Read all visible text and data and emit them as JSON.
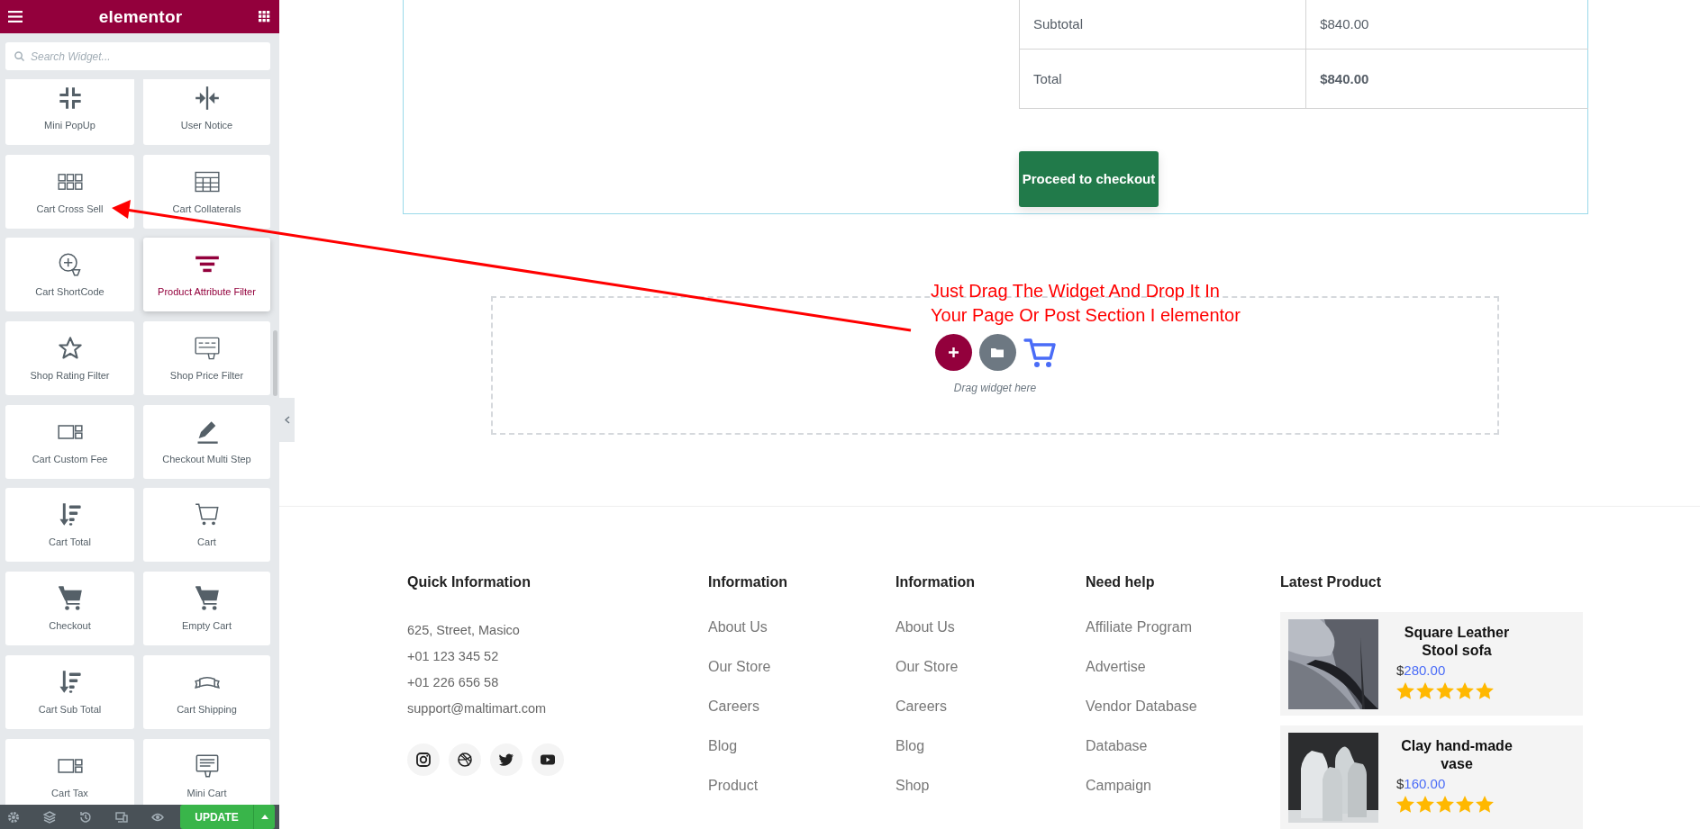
{
  "sidebar": {
    "title": "elementor",
    "search": {
      "placeholder": "Search Widget..."
    },
    "widgets": [
      {
        "label": "Mini PopUp",
        "selected": false
      },
      {
        "label": "User Notice",
        "selected": false
      },
      {
        "label": "Cart Cross Sell",
        "selected": false
      },
      {
        "label": "Cart Collaterals",
        "selected": false
      },
      {
        "label": "Cart ShortCode",
        "selected": false
      },
      {
        "label": "Product Attribute Filter",
        "selected": true
      },
      {
        "label": "Shop Rating Filter",
        "selected": false
      },
      {
        "label": "Shop Price Filter",
        "selected": false
      },
      {
        "label": "Cart Custom Fee",
        "selected": false
      },
      {
        "label": "Checkout Multi Step",
        "selected": false
      },
      {
        "label": "Cart Total",
        "selected": false
      },
      {
        "label": "Cart",
        "selected": false
      },
      {
        "label": "Checkout",
        "selected": false
      },
      {
        "label": "Empty Cart",
        "selected": false
      },
      {
        "label": "Cart Sub Total",
        "selected": false
      },
      {
        "label": "Cart Shipping",
        "selected": false
      },
      {
        "label": "Cart Tax",
        "selected": false
      },
      {
        "label": "Mini Cart",
        "selected": false
      }
    ],
    "update_button": "UPDATE"
  },
  "cart_totals": {
    "rows": [
      {
        "label": "Subtotal",
        "value": "$840.00",
        "strong": false
      },
      {
        "label": "Total",
        "value": "$840.00",
        "strong": true
      }
    ],
    "checkout_button": "Proceed to checkout"
  },
  "annotation": {
    "lines": [
      "Just Drag The Widget And Drop It In",
      "Your Page Or Post Section I elementor"
    ]
  },
  "drop_zone": {
    "hint": "Drag widget here"
  },
  "footer": {
    "contact": {
      "heading": "Quick Information",
      "lines": [
        "625, Street, Masico",
        "+01 123 345 52",
        "+01 226 656 58",
        "support@maltimart.com"
      ]
    },
    "link_columns": [
      {
        "heading": "Information",
        "links": [
          "About Us",
          "Our Store",
          "Careers",
          "Blog",
          "Product"
        ]
      },
      {
        "heading": "Information",
        "links": [
          "About Us",
          "Our Store",
          "Careers",
          "Blog",
          "Shop"
        ]
      },
      {
        "heading": "Need help",
        "links": [
          "Affiliate Program",
          "Advertise",
          "Vendor Database",
          "Database",
          "Campaign"
        ]
      }
    ],
    "latest": {
      "heading": "Latest Product",
      "products": [
        {
          "name": "Square Leather Stool sofa",
          "currency": "$",
          "amount": "280.00",
          "stars": 5
        },
        {
          "name": "Clay hand-made vase",
          "currency": "$",
          "amount": "160.00",
          "stars": 5
        }
      ]
    }
  }
}
